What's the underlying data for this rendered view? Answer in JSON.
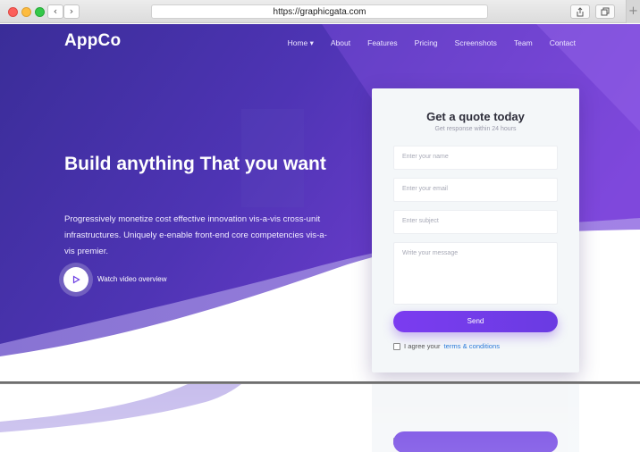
{
  "browser": {
    "url": "https://graphicgata.com",
    "back_icon": "chevron-left-icon",
    "forward_icon": "chevron-right-icon",
    "share_icon": "share-icon",
    "tabs_icon": "tabs-icon",
    "new_tab_label": "+"
  },
  "nav": {
    "logo": "AppCo",
    "items": [
      {
        "label": "Home ▾"
      },
      {
        "label": "About"
      },
      {
        "label": "Features"
      },
      {
        "label": "Pricing"
      },
      {
        "label": "Screenshots"
      },
      {
        "label": "Team"
      },
      {
        "label": "Contact"
      }
    ]
  },
  "hero": {
    "title_bold": "Build anything",
    "title_rest": " That you want",
    "description": "Progressively monetize cost effective innovation vis-a-vis cross-unit infrastructures. Uniquely e-enable front-end core competencies vis-a-vis premier.",
    "video_label": "Watch video overview"
  },
  "quote_form": {
    "title": "Get a quote today",
    "subtitle": "Get response within 24 hours",
    "name_placeholder": "Enter your name",
    "email_placeholder": "Enter your email",
    "subject_placeholder": "Enter subject",
    "message_placeholder": "Write your message",
    "send_label": "Send",
    "agree_prefix": "I agree your",
    "agree_link": "terms & conditions"
  },
  "colors": {
    "brand_purple": "#6a3be2",
    "hero_dark": "#3d2f9c",
    "link_blue": "#2b7bd9"
  }
}
